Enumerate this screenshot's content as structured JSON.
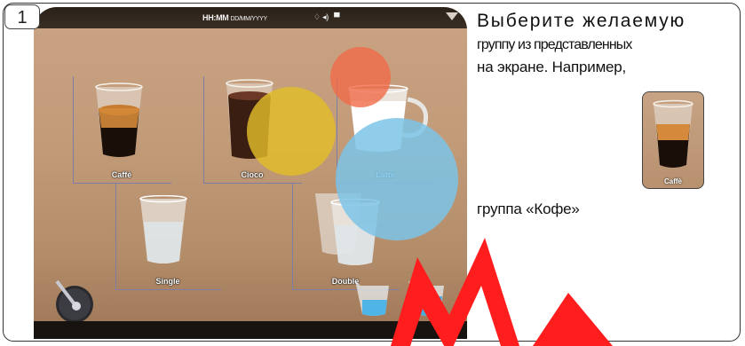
{
  "step": {
    "number": "1"
  },
  "machine_screen": {
    "status_bar": {
      "time_format": "HH:MM",
      "date_format": "DD/MM/YYYY",
      "icons": [
        "water-icon",
        "sound-icon",
        "cup-icon"
      ]
    },
    "tiles": [
      {
        "label": "Caffè"
      },
      {
        "label": "Cioco"
      },
      {
        "label": "Latte"
      },
      {
        "label": "Single"
      },
      {
        "label": "Double"
      }
    ],
    "bottom_controls": [
      "steam-wand-icon",
      "milk-pitcher-icon",
      "water-pitcher-icon"
    ]
  },
  "instruction": {
    "line1": "Выберите желаемую",
    "line2": "группу из представленных",
    "line3": "на экране. Например,",
    "line4": "группа «Кофе»"
  },
  "example_thumbnail": {
    "label": "Caffè"
  },
  "colors": {
    "circle_orange": "#f06a48",
    "circle_yellow": "#e2bd2a",
    "circle_blue": "#7dc4e8",
    "watermark_red": "#ff1d1d"
  }
}
